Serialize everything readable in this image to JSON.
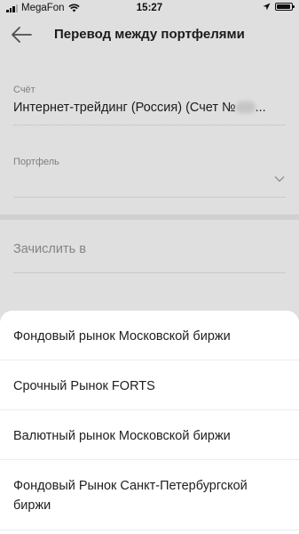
{
  "status_bar": {
    "carrier": "MegaFon",
    "time": "15:27"
  },
  "header": {
    "title": "Перевод между портфелями"
  },
  "form": {
    "account": {
      "label": "Счёт",
      "value": "Интернет-трейдинг (Россия) (Счет №",
      "value_suffix": "..."
    },
    "portfolio": {
      "label": "Портфель",
      "value": ""
    },
    "credit_to": {
      "placeholder": "Зачислить в"
    }
  },
  "picker": {
    "options": [
      "Фондовый рынок Московской биржи",
      "Срочный Рынок FORTS",
      "Валютный рынок Московской биржи",
      "Фондовый Рынок Санкт-Петербургской биржи"
    ]
  }
}
